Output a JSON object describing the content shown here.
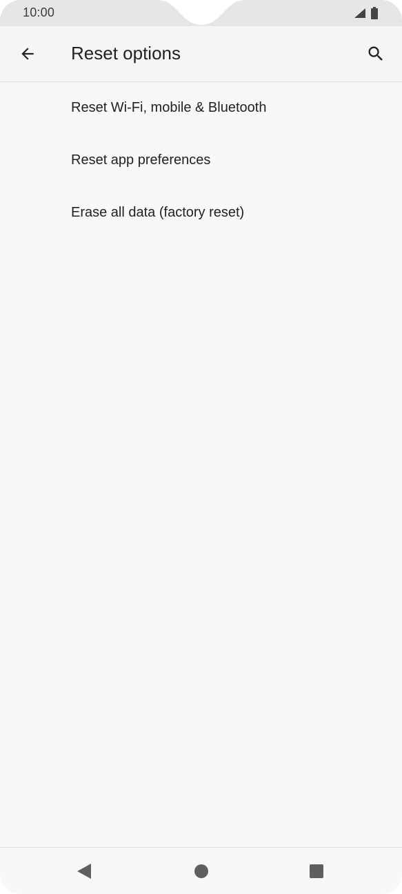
{
  "status_bar": {
    "time": "10:00",
    "icons": [
      "signal-icon",
      "battery-icon"
    ]
  },
  "app_bar": {
    "title": "Reset options",
    "back_icon": "arrow-back-icon",
    "search_icon": "search-icon"
  },
  "options": [
    {
      "label": "Reset Wi-Fi, mobile & Bluetooth"
    },
    {
      "label": "Reset app preferences"
    },
    {
      "label": "Erase all data (factory reset)"
    }
  ],
  "nav_bar": {
    "icons": [
      "nav-back-icon",
      "nav-home-icon",
      "nav-recents-icon"
    ]
  },
  "colors": {
    "background": "#f8f8f8",
    "app_bar": "#f5f5f5",
    "status_bar": "#e6e6e6",
    "text_primary": "#202124",
    "nav_icon": "#5f5f5f"
  }
}
